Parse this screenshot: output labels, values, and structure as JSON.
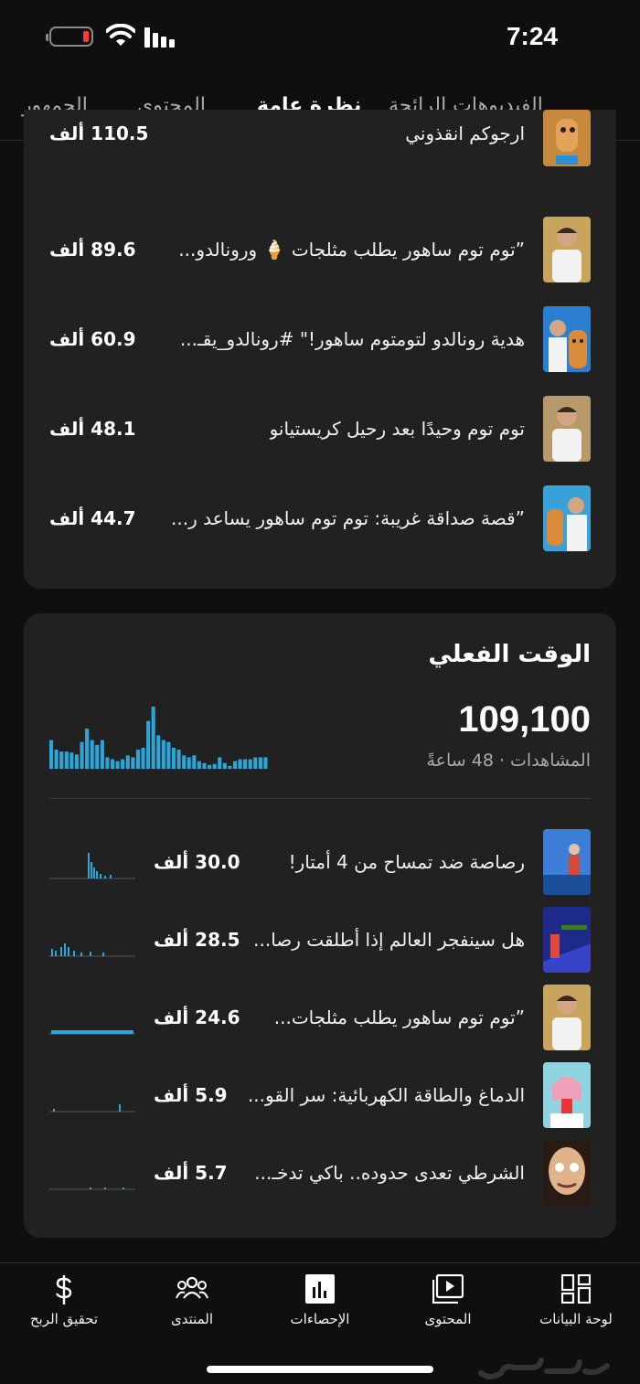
{
  "status_bar": {
    "time": "7:24"
  },
  "tabs": [
    {
      "label": "الجمهور"
    },
    {
      "label": "المحتوى"
    },
    {
      "label": "نظرة عامة",
      "active": true
    },
    {
      "label": "الفيديوهات الرائجة"
    }
  ],
  "top_videos": [
    {
      "title": "ارجوكم انقذوني",
      "views": "110.5 ألف",
      "thumb_icon": "cartoon-character-thumbnail"
    },
    {
      "title": "”توم توم ساهور يطلب مثلجات 🍦 ورونالدو...",
      "views": "89.6 ألف",
      "thumb_icon": "ronaldo-thumbnail"
    },
    {
      "title": "هدية رونالدو لتومتوم ساهور!\" #رونالدو_يقـ...",
      "views": "60.9 ألف",
      "thumb_icon": "ronaldo-cartoon-thumbnail"
    },
    {
      "title": "توم توم وحيدًا بعد رحيل كريستيانو",
      "views": "48.1 ألف",
      "thumb_icon": "ronaldo-thumbnail"
    },
    {
      "title": "”قصة صداقة غريبة: توم توم ساهور يساعد ر...",
      "views": "44.7 ألف",
      "thumb_icon": "ronaldo-cartoon-thumbnail"
    }
  ],
  "realtime": {
    "heading": "الوقت الفعلي",
    "views": "109,100",
    "subtitle": "المشاهدات · 48 ساعةً",
    "chart_data": {
      "type": "bar",
      "values": [
        30,
        20,
        18,
        18,
        17,
        15,
        28,
        42,
        30,
        25,
        30,
        12,
        10,
        8,
        10,
        14,
        12,
        20,
        22,
        50,
        65,
        35,
        30,
        28,
        22,
        20,
        14,
        12,
        14,
        8,
        6,
        4,
        5,
        12,
        6,
        3,
        8,
        10,
        10,
        10,
        12,
        12,
        12
      ]
    },
    "videos": [
      {
        "title": "رصاصة ضد تمساح من 4 أمتار!",
        "views": "30.0 ألف",
        "thumb_icon": "crocodile-thumbnail"
      },
      {
        "title": "هل سينفجر العالم إذا أطلقت رصا...",
        "views": "28.5 ألف",
        "thumb_icon": "bullet-thumbnail"
      },
      {
        "title": "”توم توم ساهور يطلب مثلجات...",
        "views": "24.6 ألف",
        "thumb_icon": "ronaldo-thumbnail"
      },
      {
        "title": "الدماغ والطاقة الكهربائية: سر القو...",
        "views": "5.9 ألف",
        "thumb_icon": "brain-thumbnail"
      },
      {
        "title": "الشرطي تعدى حدوده.. باكي تدخـ...",
        "views": "5.7 ألف",
        "thumb_icon": "anime-face-thumbnail"
      }
    ]
  },
  "bottom_nav": [
    {
      "label": "تحقيق الربح",
      "icon": "dollar-icon"
    },
    {
      "label": "المنتدى",
      "icon": "community-icon"
    },
    {
      "label": "الإحصاءات",
      "icon": "analytics-icon",
      "active": true
    },
    {
      "label": "المحتوى",
      "icon": "content-icon"
    },
    {
      "label": "لوحة البيانات",
      "icon": "dashboard-icon"
    }
  ],
  "watermark": "حراج"
}
